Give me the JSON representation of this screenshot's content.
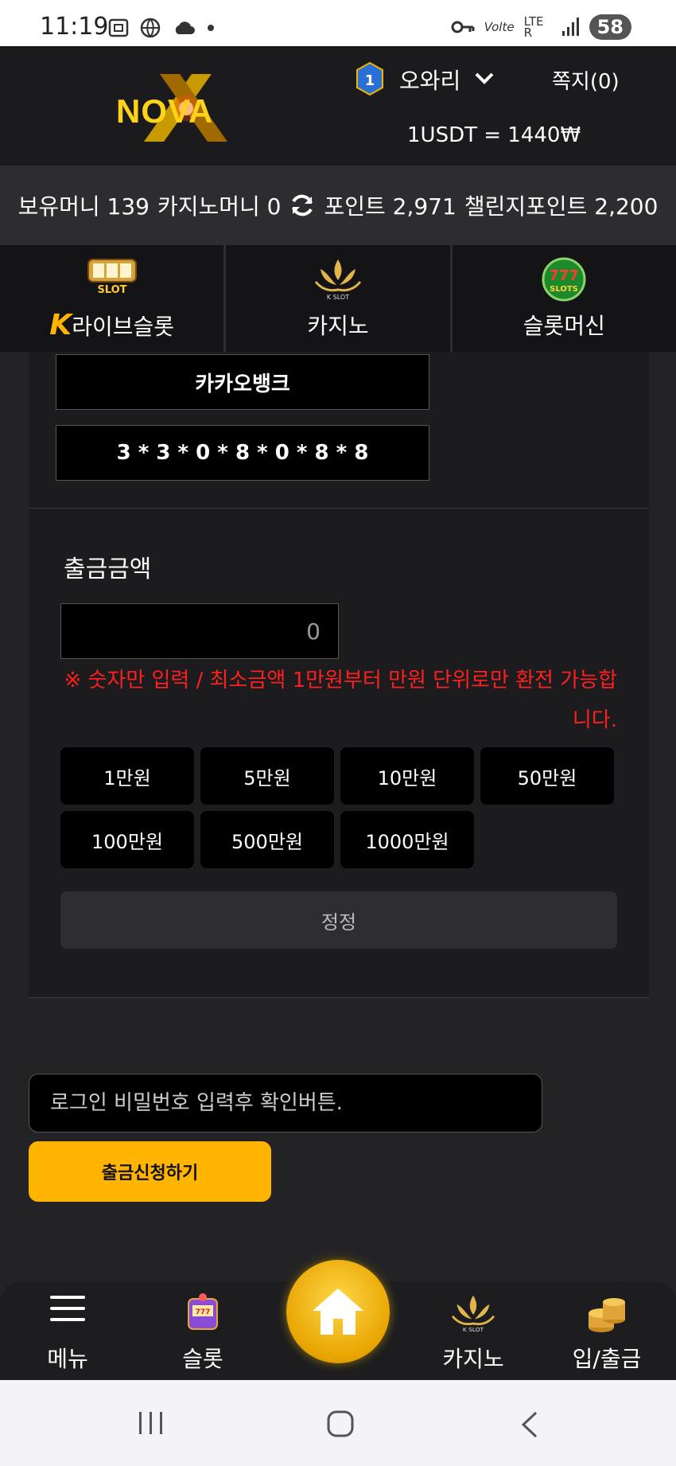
{
  "status_bar": {
    "time": "11:19",
    "battery": "58",
    "network": "LTE R"
  },
  "header": {
    "logo_text": "NOVA",
    "rank_level": "1",
    "username": "오와리",
    "messages": "쪽지(0)",
    "exchange_rate": "1USDT = 1440₩"
  },
  "balance": {
    "holding": "보유머니 139",
    "casino": "카지노머니 0",
    "points": "포인트 2,971",
    "challenge": "챌린지포인트 2,200"
  },
  "game_tabs": [
    {
      "label": "라이브슬롯",
      "icon": "live-slot-icon"
    },
    {
      "label": "카지노",
      "icon": "kslot-crown-icon"
    },
    {
      "label": "슬롯머신",
      "icon": "777-slots-icon"
    }
  ],
  "withdraw": {
    "bank_name": "카카오뱅크",
    "account_number": "3 * 3 * 0 * 8 * 0 * 8 * 8",
    "amount_label": "출금금액",
    "amount_value": "0",
    "warning": "※ 숫자만 입력 / 최소금액 1만원부터 만원 단위로만 환전 가능합니다.",
    "quick_amounts": [
      "1만원",
      "5만원",
      "10만원",
      "50만원",
      "100만원",
      "500만원",
      "1000만원"
    ],
    "reset_label": "정정",
    "password_placeholder": "로그인 비밀번호 입력후 확인버튼.",
    "submit_label": "출금신청하기"
  },
  "bottom_nav": {
    "menu": "메뉴",
    "slot": "슬롯",
    "casino": "카지노",
    "deposit": "입/출금"
  },
  "colors": {
    "accent": "#ffb400",
    "warning": "#ff1f1f",
    "background": "#232326"
  }
}
